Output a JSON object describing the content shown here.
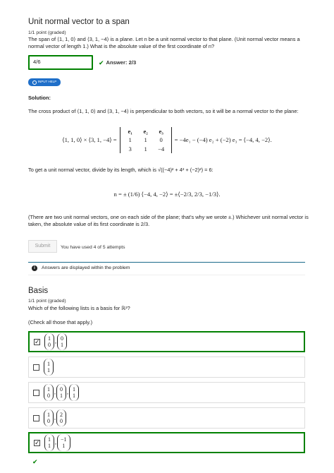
{
  "problem1": {
    "title": "Unit normal vector to a span",
    "points": "1/1 point (graded)",
    "question_line1": "The span of ⟨1, 1, 0⟩ and ⟨3, 1, −4⟩ is a plane. Let n be a unit normal vector to that plane. (Unit normal vector means a",
    "question_line2": "normal vector of length 1.) What is the absolute value of the first coordinate of n?",
    "input_value": "4/6",
    "answer_status": "Answer: 2/3",
    "help_label": "INPUT HELP",
    "solution_label": "Solution:",
    "solution_line1": "The cross product of ⟨1, 1, 0⟩ and ⟨3, 1, −4⟩ is perpendicular to both vectors, so it will be a normal vector to the plane:",
    "cross_lhs": "⟨1, 1, 0⟩ × ⟨3, 1, −4⟩ =",
    "matrix": [
      "e₁",
      "e₂",
      "e₃",
      "1",
      "1",
      "0",
      "3",
      "1",
      "−4"
    ],
    "cross_rhs": "= −4e₁ − (−4) e₂ + (−2) e₃ = ⟨−4, 4, −2⟩.",
    "unit_text": "To get a unit normal vector, divide by its length, which is √((−4)² + 4² + (−2)²) = 6:",
    "n_formula": "n = ± (1/6) ⟨−4, 4, −2⟩ = ±⟨−2/3, 2/3, −1/3⟩.",
    "note_line1": "(There are two unit normal vectors, one on each side of the plane; that's why we wrote ±.) Whichever unit normal vector is",
    "note_line2": "taken, the absolute value of its first coordinate is 2/3.",
    "submit_label": "Submit",
    "attempts": "You have used 4 of 5 attempts",
    "notice": "Answers are displayed within the problem"
  },
  "problem2": {
    "title": "Basis",
    "points": "1/1 point (graded)",
    "question": "Which of the following lists is a basis for ℝ²?",
    "hint": "(Check all those that apply.)",
    "choices": [
      {
        "checked": true,
        "correct": true,
        "vectors": [
          [
            "1",
            "0"
          ],
          [
            "0",
            "1"
          ]
        ]
      },
      {
        "checked": false,
        "correct": false,
        "vectors": [
          [
            "1",
            "1"
          ]
        ]
      },
      {
        "checked": false,
        "correct": false,
        "vectors": [
          [
            "1",
            "0"
          ],
          [
            "0",
            "1"
          ],
          [
            "1",
            "1"
          ]
        ]
      },
      {
        "checked": false,
        "correct": false,
        "vectors": [
          [
            "1",
            "0"
          ],
          [
            "2",
            "0"
          ]
        ]
      },
      {
        "checked": true,
        "correct": true,
        "vectors": [
          [
            "1",
            "1"
          ],
          [
            "−1",
            "1"
          ]
        ]
      }
    ]
  }
}
